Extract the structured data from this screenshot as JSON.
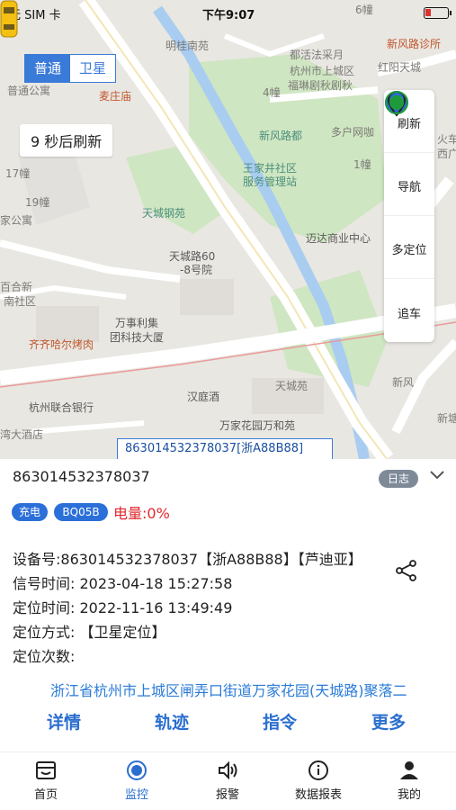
{
  "status_bar": {
    "carrier": "无 SIM 卡",
    "time": "下午9:07",
    "battery_color": "#e03030"
  },
  "map": {
    "toggle": {
      "normal": "普通",
      "satellite": "卫星",
      "selected": "普通"
    },
    "countdown": "9 秒后刷新",
    "labels": {
      "l1": "明桂南苑",
      "l2": "麦庄庙",
      "l3": "杭州市上城区",
      "l4": "都活法采月",
      "l5": "福琳剧秋剧秋",
      "l6": "新风路诊所",
      "l7": "红阳天城",
      "l8": "4幢",
      "l9": "1幢",
      "l10": "6幢",
      "l11": "新风路都",
      "l12": "多户网咖",
      "l13": "王家井社区",
      "l14": "服务管理站",
      "l15": "天城钢苑",
      "l16": "迈达商业中心",
      "l17": "天城路60",
      "l18": "-8号院",
      "l19": "万事利集",
      "l20": "团科技大厦",
      "l21": "齐齐哈尔烤肉",
      "l22": "杭州联合银行",
      "l23": "汉庭酒",
      "l24": "天城苑",
      "l25": "万家花园万和苑",
      "l26": "新风",
      "l27": "普通公寓",
      "l28": "17幢",
      "l29": "19幢",
      "l30": "家公寓",
      "l31": "百合新",
      "l32": "南社区",
      "l33": "湾大酒店",
      "l34": "火车",
      "l35": "西广",
      "l36": "新塘"
    },
    "vehicle_label": "863014532378037[浙A88B88]"
  },
  "controls": {
    "refresh": "刷新",
    "navigate": "导航",
    "multi_locate": "多定位",
    "follow": "追车"
  },
  "panel": {
    "imei": "863014532378037",
    "log_button": "日志",
    "tag_charging": "充电",
    "tag_model": "BQ05B",
    "battery": "电量:0%",
    "device_line": "设备号:863014532378037【浙A88B88】【芦迪亚】",
    "signal_time": "信号时间:  2023-04-18 15:27:58",
    "locate_time": "定位时间:  2022-11-16 13:49:49",
    "locate_mode": "定位方式:  【卫星定位】",
    "locate_count": "定位次数:",
    "address": "浙江省杭州市上城区闸弄口街道万家花园(天城路)聚落二",
    "actions": {
      "details": "详情",
      "track": "轨迹",
      "command": "指令",
      "more": "更多"
    }
  },
  "tabbar": {
    "home": "首页",
    "monitor": "监控",
    "alarm": "报警",
    "reports": "数据报表",
    "mine": "我的",
    "active": "监控"
  },
  "colors": {
    "accent": "#2a6ecf",
    "danger": "#e0282e",
    "follow_green": "#1e9a3c"
  }
}
